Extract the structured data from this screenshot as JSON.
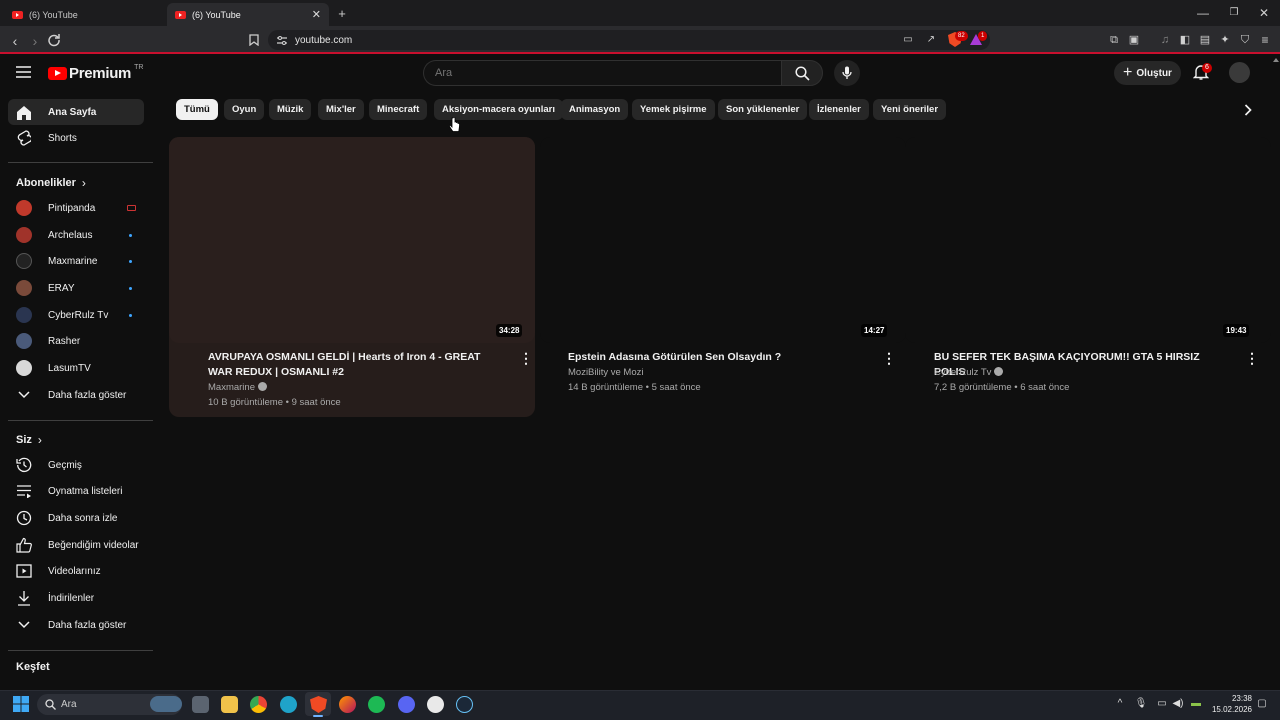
{
  "browser": {
    "tabs": [
      {
        "title": "(6) YouTube"
      },
      {
        "title": "(6) YouTube"
      }
    ],
    "url": "youtube.com",
    "shield_count": "82",
    "rewards_badge": "1"
  },
  "header": {
    "logo_text": "Premium",
    "region": "TR",
    "search_placeholder": "Ara",
    "create_label": "Oluştur",
    "notification_count": "6"
  },
  "sidebar": {
    "primary": [
      {
        "label": "Ana Sayfa"
      },
      {
        "label": "Shorts"
      }
    ],
    "subs_title": "Abonelikler",
    "subscriptions": [
      {
        "label": "Pintipanda",
        "color": "#c0392b"
      },
      {
        "label": "Archelaus",
        "color": "#a0332a"
      },
      {
        "label": "Maxmarine",
        "color": "#222222"
      },
      {
        "label": "ERAY",
        "color": "#7a4a3a"
      },
      {
        "label": "CyberRulz Tv",
        "color": "#2a3550"
      },
      {
        "label": "Rasher",
        "color": "#4a5a7a"
      },
      {
        "label": "LasumTV",
        "color": "#d8d8d8"
      }
    ],
    "subs_more": "Daha fazla göster",
    "you_title": "Siz",
    "you_items": [
      {
        "label": "Geçmiş"
      },
      {
        "label": "Oynatma listeleri"
      },
      {
        "label": "Daha sonra izle"
      },
      {
        "label": "Beğendiğim videolar"
      },
      {
        "label": "Videolarınız"
      },
      {
        "label": "İndirilenler"
      },
      {
        "label": "Daha fazla göster"
      }
    ],
    "explore_title": "Keşfet"
  },
  "chips": [
    {
      "label": "Tümü"
    },
    {
      "label": "Oyun"
    },
    {
      "label": "Müzik"
    },
    {
      "label": "Mix'ler"
    },
    {
      "label": "Minecraft"
    },
    {
      "label": "Aksiyon-macera oyunları"
    },
    {
      "label": "Animasyon"
    },
    {
      "label": "Yemek pişirme"
    },
    {
      "label": "Son yüklenenler"
    },
    {
      "label": "İzlenenler"
    },
    {
      "label": "Yeni öneriler"
    }
  ],
  "videos": [
    {
      "title": "AVRUPAYA OSMANLI GELDİ | Hearts of Iron 4 - GREAT WAR REDUX | OSMANLI #2",
      "channel": "Maxmarine",
      "stats": "10 B görüntüleme • 9 saat önce",
      "duration": "34:28"
    },
    {
      "title": "Epstein Adasına Götürülen Sen Olsaydın ?",
      "channel": "MoziBility ve Mozi",
      "stats": "14 B görüntüleme • 5 saat önce",
      "duration": "14:27"
    },
    {
      "title": "BU SEFER TEK BAŞIMA KAÇIYORUM!! GTA 5 HIRSIZ POLIS",
      "channel": "CyberRulz Tv",
      "stats": "7,2 B görüntüleme • 6 saat önce",
      "duration": "19:43"
    }
  ],
  "taskbar": {
    "search_label": "Ara",
    "time": "23:38",
    "date": "15.02.2026"
  }
}
